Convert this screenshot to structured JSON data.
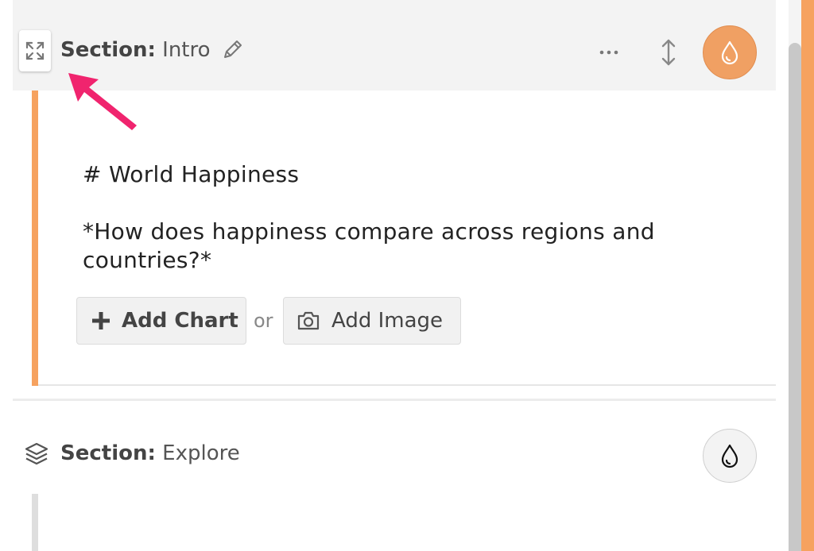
{
  "section_intro": {
    "label_prefix": "Section:",
    "name": "Intro",
    "icons": {
      "expand": "expand-arrows-icon",
      "edit": "pencil-icon",
      "more": "ellipsis-icon",
      "reorder": "vertical-resize-arrows-icon",
      "style": "water-drop-icon"
    },
    "content_heading": "# World Happiness",
    "content_subtitle": "*How does happiness compare across regions and countries?*",
    "add_chart_label": "Add Chart",
    "or_label": "or",
    "add_image_label": "Add Image"
  },
  "section_explore": {
    "label_prefix": "Section:",
    "name": "Explore",
    "icons": {
      "layers": "layers-icon",
      "style": "water-drop-icon"
    }
  },
  "colors": {
    "accent_orange": "#f6a25f",
    "drop_button_orange": "#f0a063",
    "annotation_arrow": "#f0246e",
    "header_bg": "#f3f3f3"
  }
}
